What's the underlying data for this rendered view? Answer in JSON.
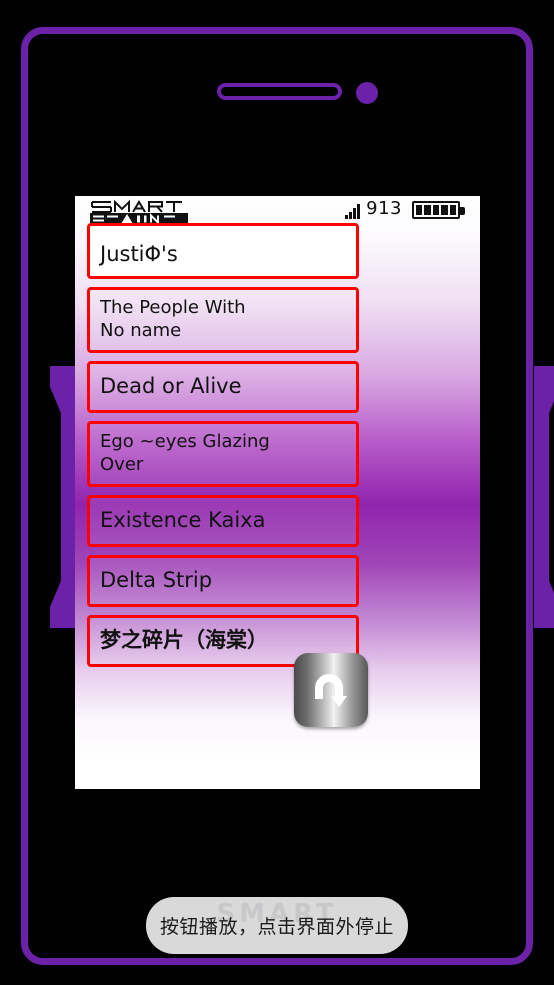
{
  "device": {
    "frame_color": "#6B21A8",
    "speaker_name": "speaker-grille",
    "camera_name": "camera-dot"
  },
  "status_bar": {
    "logo_text": "SMART BRAIN",
    "signal_icon": "signal-bars-icon",
    "signal_count": "913",
    "battery_icon": "battery-icon",
    "battery_segments": 5
  },
  "song_list": {
    "items": [
      {
        "lines": [
          "JustiΦ's"
        ],
        "style": "first"
      },
      {
        "lines": [
          "The People With",
          "No name"
        ],
        "style": "two-line"
      },
      {
        "lines": [
          "Dead or Alive"
        ],
        "style": ""
      },
      {
        "lines": [
          "Ego ~eyes Glazing",
          "Over"
        ],
        "style": "two-line"
      },
      {
        "lines": [
          "Existence Kaixa"
        ],
        "style": ""
      },
      {
        "lines": [
          "Delta Strip"
        ],
        "style": ""
      },
      {
        "lines": [
          "梦之碎片（海棠）"
        ],
        "style": "cjk"
      }
    ],
    "border_color": "#FF0000"
  },
  "refresh_button": {
    "icon": "u-turn-arrow-icon",
    "label": "refresh"
  },
  "toast": {
    "text": "按钮播放，点击界面外停止",
    "watermark": "SMART"
  }
}
